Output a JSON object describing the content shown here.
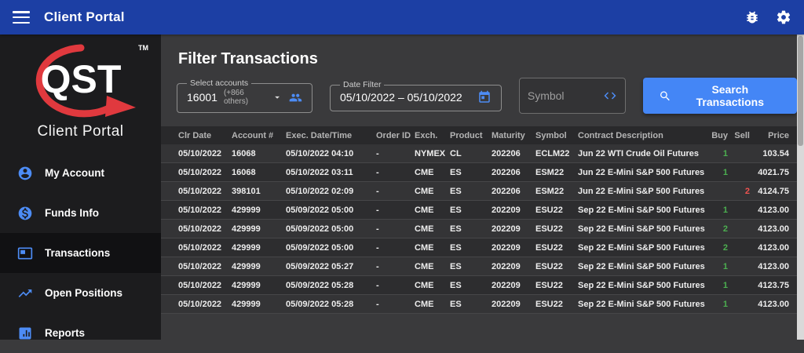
{
  "topbar": {
    "title": "Client Portal"
  },
  "sidebar": {
    "logo": {
      "text": "QST",
      "tm": "TM",
      "caption": "Client Portal"
    },
    "items": [
      {
        "label": "My Account"
      },
      {
        "label": "Funds Info"
      },
      {
        "label": "Transactions"
      },
      {
        "label": "Open Positions"
      },
      {
        "label": "Reports"
      }
    ],
    "selected": "Transactions"
  },
  "filters": {
    "title": "Filter Transactions",
    "accounts": {
      "label": "Select accounts",
      "value": "16001",
      "suffix": "(+866 others)"
    },
    "date": {
      "label": "Date Filter",
      "value": "05/10/2022 – 05/10/2022"
    },
    "symbol": {
      "placeholder": "Symbol"
    },
    "search_label": "Search Transactions"
  },
  "table": {
    "columns": [
      "Clr Date",
      "Account #",
      "Exec. Date/Time",
      "Order ID",
      "Exch.",
      "Product",
      "Maturity",
      "Symbol",
      "Contract Description",
      "Buy",
      "Sell",
      "Price"
    ],
    "rows": [
      {
        "clr_date": "05/10/2022",
        "account": "16068",
        "exec": "05/10/2022 04:10",
        "order_id": "-",
        "exch": "NYMEX",
        "product": "CL",
        "maturity": "202206",
        "symbol": "ECLM22",
        "desc": "Jun 22 WTI Crude Oil Futures",
        "buy": "1",
        "sell": "",
        "price": "103.54"
      },
      {
        "clr_date": "05/10/2022",
        "account": "16068",
        "exec": "05/10/2022 03:11",
        "order_id": "-",
        "exch": "CME",
        "product": "ES",
        "maturity": "202206",
        "symbol": "ESM22",
        "desc": "Jun 22 E-Mini S&P 500 Futures",
        "buy": "1",
        "sell": "",
        "price": "4021.75"
      },
      {
        "clr_date": "05/10/2022",
        "account": "398101",
        "exec": "05/10/2022 02:09",
        "order_id": "-",
        "exch": "CME",
        "product": "ES",
        "maturity": "202206",
        "symbol": "ESM22",
        "desc": "Jun 22 E-Mini S&P 500 Futures",
        "buy": "",
        "sell": "2",
        "price": "4124.75"
      },
      {
        "clr_date": "05/10/2022",
        "account": "429999",
        "exec": "05/09/2022 05:00",
        "order_id": "-",
        "exch": "CME",
        "product": "ES",
        "maturity": "202209",
        "symbol": "ESU22",
        "desc": "Sep 22 E-Mini S&P 500 Futures",
        "buy": "1",
        "sell": "",
        "price": "4123.00"
      },
      {
        "clr_date": "05/10/2022",
        "account": "429999",
        "exec": "05/09/2022 05:00",
        "order_id": "-",
        "exch": "CME",
        "product": "ES",
        "maturity": "202209",
        "symbol": "ESU22",
        "desc": "Sep 22 E-Mini S&P 500 Futures",
        "buy": "2",
        "sell": "",
        "price": "4123.00"
      },
      {
        "clr_date": "05/10/2022",
        "account": "429999",
        "exec": "05/09/2022 05:00",
        "order_id": "-",
        "exch": "CME",
        "product": "ES",
        "maturity": "202209",
        "symbol": "ESU22",
        "desc": "Sep 22 E-Mini S&P 500 Futures",
        "buy": "2",
        "sell": "",
        "price": "4123.00"
      },
      {
        "clr_date": "05/10/2022",
        "account": "429999",
        "exec": "05/09/2022 05:27",
        "order_id": "-",
        "exch": "CME",
        "product": "ES",
        "maturity": "202209",
        "symbol": "ESU22",
        "desc": "Sep 22 E-Mini S&P 500 Futures",
        "buy": "1",
        "sell": "",
        "price": "4123.00"
      },
      {
        "clr_date": "05/10/2022",
        "account": "429999",
        "exec": "05/09/2022 05:28",
        "order_id": "-",
        "exch": "CME",
        "product": "ES",
        "maturity": "202209",
        "symbol": "ESU22",
        "desc": "Sep 22 E-Mini S&P 500 Futures",
        "buy": "1",
        "sell": "",
        "price": "4123.75"
      },
      {
        "clr_date": "05/10/2022",
        "account": "429999",
        "exec": "05/09/2022 05:28",
        "order_id": "-",
        "exch": "CME",
        "product": "ES",
        "maturity": "202209",
        "symbol": "ESU22",
        "desc": "Sep 22 E-Mini S&P 500 Futures",
        "buy": "1",
        "sell": "",
        "price": "4123.00"
      }
    ]
  },
  "colors": {
    "topbar_blue": "#1c3fa4",
    "accent_blue": "#4486f6",
    "buy_green": "#4caf50",
    "sell_red": "#ef5350",
    "logo_red": "#e0393e"
  },
  "icons": [
    "menu-icon",
    "debug-icon",
    "settings-gear-icon",
    "account-icon",
    "funds-icon",
    "transactions-icon",
    "positions-icon",
    "reports-icon",
    "dropdown-caret-icon",
    "people-icon",
    "calendar-icon",
    "code-icon",
    "search-icon"
  ]
}
